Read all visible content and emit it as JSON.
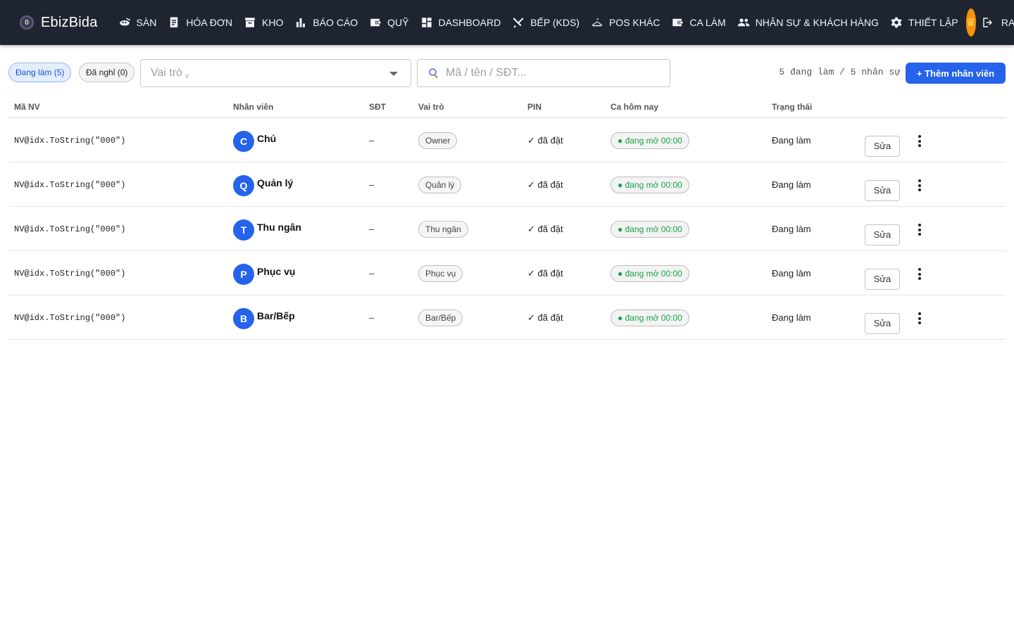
{
  "brand": {
    "name": "EbizBida",
    "logo_letter": "0"
  },
  "nav": [
    {
      "label": "SÀN",
      "icon": "billiard-icon"
    },
    {
      "label": "HÓA ĐƠN",
      "icon": "receipt-icon"
    },
    {
      "label": "KHO",
      "icon": "archive-icon"
    },
    {
      "label": "BÁO CÁO",
      "icon": "bar-chart-icon"
    },
    {
      "label": "QUỸ",
      "icon": "wallet-icon"
    },
    {
      "label": "DASHBOARD",
      "icon": "dashboard-icon"
    },
    {
      "label": "BẾP (KDS)",
      "icon": "utensils-icon"
    },
    {
      "label": "POS KHÁC",
      "icon": "hanger-icon"
    },
    {
      "label": "CA LÀM",
      "icon": "wallet-icon"
    },
    {
      "label": "NHÂN SỰ & KHÁCH HÀNG",
      "icon": "people-icon"
    },
    {
      "label": "THIẾT LẬP",
      "icon": "gear-icon"
    }
  ],
  "header": {
    "avatar_icon": "crown-icon",
    "logout_label": "RA"
  },
  "filters": {
    "active_chip": "Đang làm (5)",
    "inactive_chip": "Đã nghỉ (0)",
    "role_placeholder": "Vai trò",
    "role_small": "v",
    "search_placeholder": "Mã / tên / SĐT..."
  },
  "summary": "5 đang làm / 5 nhân sự",
  "add_button": "+ Thêm nhân viên",
  "columns": {
    "code": "Mã NV",
    "employee": "Nhân viên",
    "phone": "SĐT",
    "role": "Vai trò",
    "pin": "PIN",
    "shift": "Ca hôm nay",
    "status": "Trạng thái"
  },
  "rows": [
    {
      "code": "NV@idx.ToString(\"000\")",
      "initial": "C",
      "name": "Chủ",
      "phone": "–",
      "role": "Owner",
      "pin": "✓ đã đặt",
      "shift": "● đang mở 00:00",
      "status": "Đang làm",
      "edit": "Sửa"
    },
    {
      "code": "NV@idx.ToString(\"000\")",
      "initial": "Q",
      "name": "Quản lý",
      "phone": "–",
      "role": "Quản lý",
      "pin": "✓ đã đặt",
      "shift": "● đang mở 00:00",
      "status": "Đang làm",
      "edit": "Sửa"
    },
    {
      "code": "NV@idx.ToString(\"000\")",
      "initial": "T",
      "name": "Thu ngân",
      "phone": "–",
      "role": "Thu ngân",
      "pin": "✓ đã đặt",
      "shift": "● đang mở 00:00",
      "status": "Đang làm",
      "edit": "Sửa"
    },
    {
      "code": "NV@idx.ToString(\"000\")",
      "initial": "P",
      "name": "Phục vụ",
      "phone": "–",
      "role": "Phục vụ",
      "pin": "✓ đã đặt",
      "shift": "● đang mở 00:00",
      "status": "Đang làm",
      "edit": "Sửa"
    },
    {
      "code": "NV@idx.ToString(\"000\")",
      "initial": "B",
      "name": "Bar/Bếp",
      "phone": "–",
      "role": "Bar/Bếp",
      "pin": "✓ đã đặt",
      "shift": "● đang mở 00:00",
      "status": "Đang làm",
      "edit": "Sửa"
    }
  ],
  "colors": {
    "topbar": "#1f2530",
    "accent": "#2563eb",
    "crown": "#f5930b",
    "shift_text": "#16a34a"
  }
}
